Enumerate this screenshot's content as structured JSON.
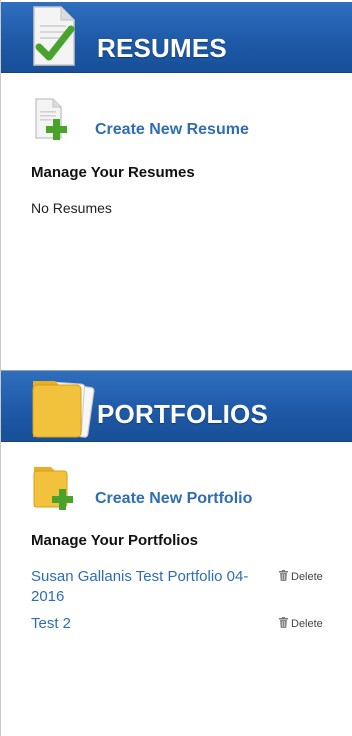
{
  "resumes": {
    "header_title": "RESUMES",
    "create_label": "Create New Resume",
    "manage_heading": "Manage Your Resumes",
    "empty_text": "No Resumes"
  },
  "portfolios": {
    "header_title": "PORTFOLIOS",
    "create_label": "Create New Portfolio",
    "manage_heading": "Manage Your Portfolios",
    "items": [
      {
        "name": "Susan Gallanis Test Portfolio 04-2016",
        "delete_label": "Delete"
      },
      {
        "name": "Test 2",
        "delete_label": "Delete"
      }
    ]
  },
  "colors": {
    "header_blue": "#1f5aa8",
    "link_blue": "#2f6db5",
    "check_green": "#49a22a",
    "folder_yellow": "#f2c23c"
  },
  "icons": {
    "resume_header": "document-check-icon",
    "resume_create": "document-add-icon",
    "portfolio_header": "folder-icon",
    "portfolio_create": "folder-add-icon",
    "delete": "trash-icon"
  }
}
